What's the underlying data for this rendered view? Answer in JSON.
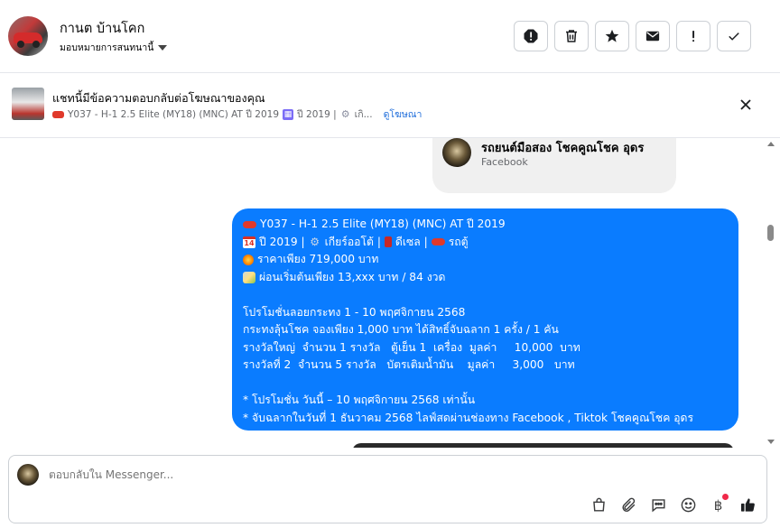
{
  "header": {
    "contact_name": "กานต บ้านโคก",
    "assign_label": "มอบหมายการสนทนานี้",
    "actions": [
      {
        "name": "spam-button",
        "icon": "alert-octagon-icon"
      },
      {
        "name": "delete-button",
        "icon": "trash-icon"
      },
      {
        "name": "star-button",
        "icon": "star-icon"
      },
      {
        "name": "mark-unread-button",
        "icon": "envelope-icon"
      },
      {
        "name": "follow-up-button",
        "icon": "exclamation-icon"
      },
      {
        "name": "done-button",
        "icon": "check-icon"
      }
    ]
  },
  "ad_banner": {
    "title": "แชทนี้มีข้อความตอบกลับต่อโฆษณาของคุณ",
    "subtitle_a": "Y037 - H-1 2.5 Elite (MY18) (MNC) AT ปี 2019",
    "subtitle_b": "ปี 2019 |",
    "subtitle_c": "เกิ...",
    "link": "ดูโฆษณา"
  },
  "page_card": {
    "name": "รถยนต์มือสอง โชคคูณโชค อุดร",
    "source": "Facebook"
  },
  "message": {
    "l1": "Y037 - H-1 2.5 Elite (MY18) (MNC) AT ปี 2019",
    "l2a": "ปี 2019 |",
    "l2b": "เกียร์ออโต้ |",
    "l2c": "ดีเซล |",
    "l2d": "รถตู้",
    "l3": "ราคาเพียง 719,000 บาท",
    "l4": "ผ่อนเริ่มต้นเพียง 13,xxx บาท / 84 งวด",
    "l5": "โปรโมชั่นลอยกระทง 1 - 10 พฤศจิกายน 2568",
    "l6": "กระทงลุ้นโชค จองเพียง 1,000 บาท ได้สิทธิ์จับฉลาก 1 ครั้ง /  1 คัน",
    "l7": "รางวัลใหญ่  จำนวน 1 รางวัล   ตู้เย็น 1  เครื่อง  มูลค่า     10,000  บาท",
    "l8": "รางวัลที่ 2  จำนวน 5 รางวัล   บัตรเติมน้ำมัน    มูลค่า     3,000   บาท",
    "l9": "* โปรโมชั่น วันนี้ – 10 พฤศจิกายน 2568 เท่านั้น",
    "l10": "* จับฉลากในวันที่ 1 ธันวาคม 2568 ไลฟ์สดผ่านช่องทาง Facebook , Tiktok โชคคูณโชค อุดร"
  },
  "composer": {
    "placeholder": "ตอบกลับใน Messenger...",
    "baht_symbol": "฿",
    "tools": [
      "bag-icon",
      "paperclip-icon",
      "message-icon",
      "emoji-icon",
      "baht-icon",
      "thumbs-up-icon"
    ]
  },
  "colors": {
    "bubble": "#0a7cff",
    "link": "#216fdb",
    "border": "#ccd0d5"
  }
}
